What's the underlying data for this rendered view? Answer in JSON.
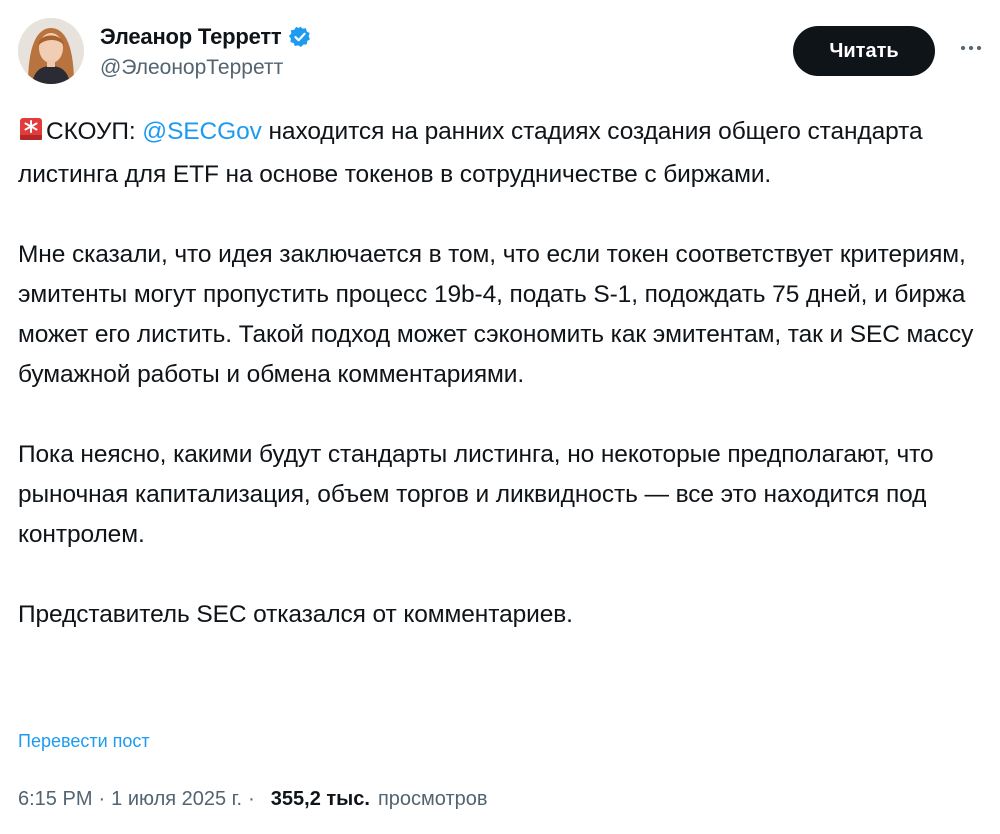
{
  "author": {
    "display_name": "Элеанор Терретт",
    "handle": "@ЭлеонорТерретт",
    "verified_icon": "verified-badge-icon",
    "verified_color": "#1d9bf0"
  },
  "actions": {
    "follow_label": "Читать",
    "more_icon": "more-dots-icon"
  },
  "tweet": {
    "p1_prefix": "СКОУП: ",
    "p1_mention": "@SECGov",
    "p1_rest": " находится на ранних стадиях создания общего стандарта листинга для ETF на основе токенов в сотрудничестве с биржами.",
    "p2": "Мне сказали, что идея заключается в том, что если токен соответствует критериям, эмитенты могут пропустить процесс 19b-4, подать S-1, подождать 75 дней, и биржа может его листить. Такой подход может сэкономить как эмитентам, так и SEC массу бумажной работы и обмена комментариями.",
    "p3": "Пока неясно, какими будут стандарты листинга, но некоторые предполагают, что рыночная капитализация, объем торгов и ликвидность — все это находится под контролем.",
    "p4": "Представитель SEC отказался от комментариев.",
    "siren_icon": "siren-emoji-icon"
  },
  "translate_label": "Перевести пост",
  "meta": {
    "time": "6:15 PM",
    "separator": "·",
    "date": "1 июля 2025 г.",
    "views_count": "355,2 тыс.",
    "views_label": "просмотров"
  },
  "colors": {
    "accent": "#1d9bf0",
    "text": "#0f1419",
    "secondary": "#536471",
    "button_bg": "#0f1419"
  }
}
